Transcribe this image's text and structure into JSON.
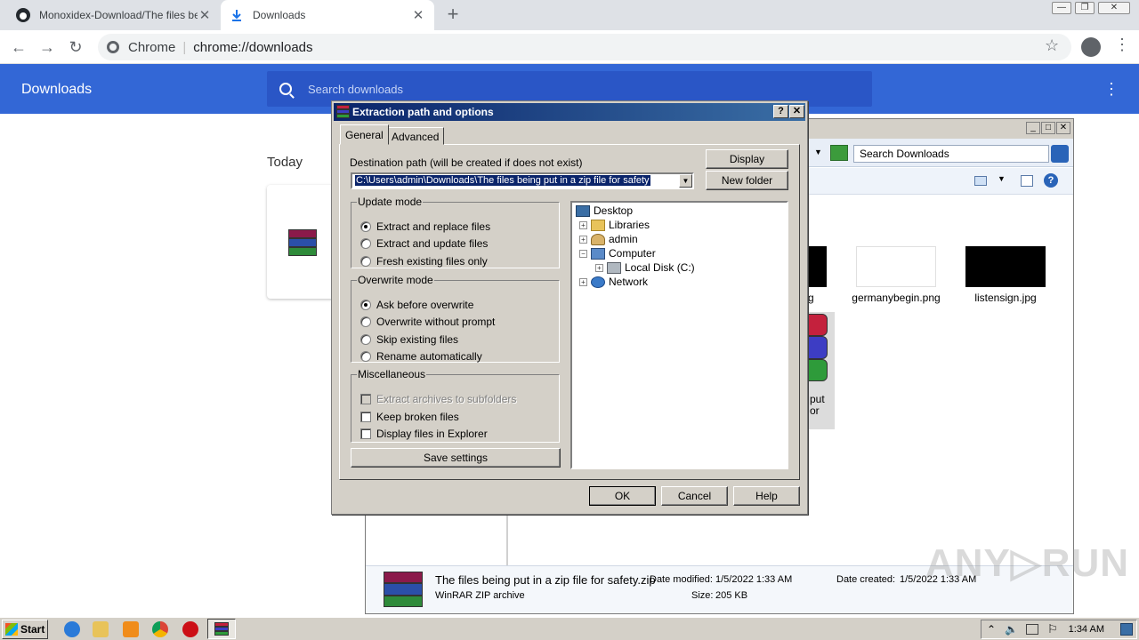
{
  "browser": {
    "tabs": [
      {
        "title": "Monoxidex-Download/The files being",
        "icon": "github-icon",
        "close": "✕"
      },
      {
        "title": "Downloads",
        "icon": "download-icon",
        "close": "✕"
      }
    ],
    "new_tab": "+",
    "omnibox": {
      "scheme_label": "Chrome",
      "url": "chrome://downloads"
    },
    "window_controls": {
      "minimize": "—",
      "restore": "❐",
      "close": "✕"
    }
  },
  "downloads_page": {
    "title": "Downloads",
    "search_placeholder": "Search downloads",
    "section": "Today"
  },
  "explorer": {
    "search_placeholder": "Search Downloads",
    "thumbnails": [
      {
        "caption": "germanybegin.png"
      },
      {
        "caption": "listensign.jpg"
      }
    ],
    "partial_caption_left": "g",
    "partial_selected_caption": [
      "put",
      "or"
    ],
    "details": {
      "name": "The files being put in a zip file for safety.zip",
      "date_modified_label": "Date modified:",
      "date_modified": "1/5/2022 1:33 AM",
      "date_created_label": "Date created:",
      "date_created": "1/5/2022 1:33 AM",
      "type": "WinRAR ZIP archive",
      "size_label": "Size:",
      "size": "205 KB"
    }
  },
  "dialog": {
    "title": "Extraction path and options",
    "help_btn": "?",
    "close_btn": "✕",
    "tabs": [
      "General",
      "Advanced"
    ],
    "dest_label": "Destination path (will be created if does not exist)",
    "dest_value": "C:\\Users\\admin\\Downloads\\The files being put in a zip file for safety",
    "buttons": {
      "display": "Display",
      "new_folder": "New folder",
      "save": "Save settings",
      "ok": "OK",
      "cancel": "Cancel",
      "help": "Help"
    },
    "update_mode": {
      "legend": "Update mode",
      "options": [
        "Extract and replace files",
        "Extract and update files",
        "Fresh existing files only"
      ],
      "selected": 0
    },
    "overwrite_mode": {
      "legend": "Overwrite mode",
      "options": [
        "Ask before overwrite",
        "Overwrite without prompt",
        "Skip existing files",
        "Rename automatically"
      ],
      "selected": 0
    },
    "misc": {
      "legend": "Miscellaneous",
      "options": [
        {
          "label": "Extract archives to subfolders",
          "checked": false,
          "disabled": true
        },
        {
          "label": "Keep broken files",
          "checked": false,
          "disabled": false
        },
        {
          "label": "Display files in Explorer",
          "checked": false,
          "disabled": false
        }
      ]
    },
    "tree": [
      {
        "label": "Desktop",
        "expander": ""
      },
      {
        "label": "Libraries",
        "expander": "+"
      },
      {
        "label": "admin",
        "expander": "+"
      },
      {
        "label": "Computer",
        "expander": "−"
      },
      {
        "label": "Local Disk (C:)",
        "expander": "+"
      },
      {
        "label": "Network",
        "expander": "+"
      }
    ]
  },
  "taskbar": {
    "start": "Start",
    "clock": "1:34 AM"
  },
  "watermark": "ANY▷RUN"
}
